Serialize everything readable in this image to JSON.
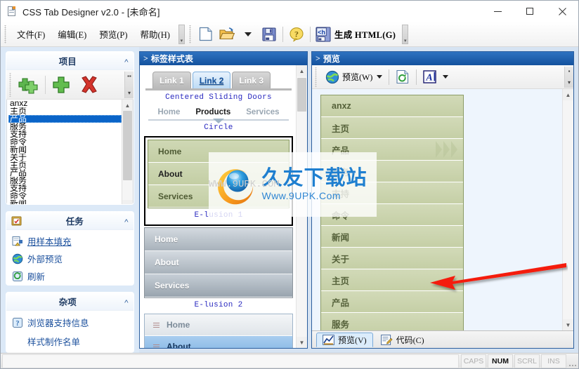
{
  "window": {
    "title": "CSS Tab Designer v2.0 - [未命名]",
    "icon": "document-icon",
    "minimize": "–",
    "maximize": "□",
    "close": "×"
  },
  "menu": {
    "items": [
      {
        "label": "文件(F)",
        "name": "menu-file"
      },
      {
        "label": "编辑(E)",
        "name": "menu-edit"
      },
      {
        "label": "预览(P)",
        "name": "menu-preview"
      },
      {
        "label": "帮助(H)",
        "name": "menu-help"
      }
    ]
  },
  "toolbar": {
    "buttons": [
      {
        "name": "new-file-button",
        "icon": "new-document-icon"
      },
      {
        "name": "open-file-button",
        "icon": "open-folder-icon"
      },
      {
        "name": "open-recent-dropdown",
        "icon": "chevron-down-icon"
      },
      {
        "name": "save-button",
        "icon": "floppy-disk-icon"
      },
      {
        "name": "help-button",
        "icon": "question-mark-icon"
      }
    ],
    "generate_html": {
      "label": "生成 HTML(G)",
      "icon": "generate-html-icon"
    }
  },
  "sidebar": {
    "items_panel": {
      "title": "项目",
      "collapse": "˄",
      "toolbar": [
        {
          "name": "add-multiple-items-button",
          "icon": "double-plus-icon"
        },
        {
          "name": "add-item-button",
          "icon": "plus-icon"
        },
        {
          "name": "delete-item-button",
          "icon": "red-x-icon"
        }
      ],
      "list": [
        {
          "label": "anxz",
          "selected": false
        },
        {
          "label": "主页",
          "selected": false
        },
        {
          "label": "产品",
          "selected": true
        },
        {
          "label": "服务",
          "selected": false
        },
        {
          "label": "支持",
          "selected": false
        },
        {
          "label": "命令",
          "selected": false
        },
        {
          "label": "新闻",
          "selected": false
        },
        {
          "label": "关于",
          "selected": false
        },
        {
          "label": "主页",
          "selected": false
        },
        {
          "label": "产品",
          "selected": false
        },
        {
          "label": "服务",
          "selected": false
        },
        {
          "label": "支持",
          "selected": false
        },
        {
          "label": "命令",
          "selected": false
        },
        {
          "label": "新闻",
          "selected": false
        }
      ]
    },
    "tasks_panel": {
      "title": "任务",
      "collapse": "˄",
      "icon": "clipboard-icon",
      "links": [
        {
          "label": "用样本填充",
          "icon": "fill-sample-icon",
          "underline": true
        },
        {
          "label": "外部预览",
          "icon": "globe-icon",
          "underline": false
        },
        {
          "label": "刷新",
          "icon": "refresh-icon",
          "underline": false
        }
      ]
    },
    "misc_panel": {
      "title": "杂项",
      "collapse": "˄",
      "links": [
        {
          "label": "浏览器支持信息",
          "icon": "browser-info-icon",
          "has_icon": true
        },
        {
          "label": "样式制作名单",
          "icon": "",
          "has_icon": false
        }
      ]
    }
  },
  "middle_panel": {
    "header": "标签样式表",
    "caret": ">",
    "sliding_doors": {
      "tabs": [
        {
          "label": "Link 1",
          "active": false
        },
        {
          "label": "Link 2",
          "active": true
        },
        {
          "label": "Link 3",
          "active": false
        }
      ],
      "caption": "Centered Sliding Doors"
    },
    "circle": {
      "items": [
        {
          "label": "Home",
          "active": false
        },
        {
          "label": "Products",
          "active": true
        },
        {
          "label": "Services",
          "active": false
        }
      ],
      "caption": "Circle"
    },
    "elusion1": {
      "items": [
        {
          "label": "Home",
          "dark": false
        },
        {
          "label": "About",
          "dark": true
        },
        {
          "label": "Services",
          "dark": false
        }
      ],
      "caption": "E-lusion 1"
    },
    "elusion2": {
      "items": [
        {
          "label": "Home",
          "on": false
        },
        {
          "label": "About",
          "on": false
        },
        {
          "label": "Services",
          "on": true
        }
      ],
      "caption": "E-lusion 2"
    },
    "bluelist": {
      "items": [
        {
          "label": "Home",
          "selected": false
        },
        {
          "label": "About",
          "selected": true
        }
      ]
    }
  },
  "preview_panel": {
    "header": "预览",
    "caret": ">",
    "toolbar": {
      "preview_button": {
        "label": "预览(W)",
        "icon": "globe-icon"
      },
      "refresh_button": {
        "name": "refresh-button",
        "icon": "refresh-page-icon"
      },
      "font_button": {
        "name": "font-button",
        "icon": "font-A-icon"
      }
    },
    "list": [
      {
        "label": "anxz",
        "chevrons": false
      },
      {
        "label": "主页",
        "chevrons": false
      },
      {
        "label": "产品",
        "chevrons": true
      },
      {
        "label": "服务",
        "chevrons": false
      },
      {
        "label": "支持",
        "chevrons": false
      },
      {
        "label": "命令",
        "chevrons": false
      },
      {
        "label": "新闻",
        "chevrons": false
      },
      {
        "label": "关于",
        "chevrons": false
      },
      {
        "label": "主页",
        "chevrons": false
      },
      {
        "label": "产品",
        "chevrons": false
      },
      {
        "label": "服务",
        "chevrons": false
      }
    ],
    "bottom_tabs": [
      {
        "label": "预览(V)",
        "icon": "preview-chart-icon",
        "active": true
      },
      {
        "label": "代码(C)",
        "icon": "code-edit-icon",
        "active": false
      }
    ]
  },
  "watermark": {
    "chinese": "久友下载站",
    "english": "Www.9UPK.Com",
    "ghost": "WWW.9UPK.COM"
  },
  "statusbar": {
    "cells": [
      {
        "label": "CAPS",
        "active": false
      },
      {
        "label": "NUM",
        "active": true
      },
      {
        "label": "SCRL",
        "active": false
      },
      {
        "label": "INS",
        "active": false
      }
    ]
  },
  "colors": {
    "accent": "#15529e",
    "dock_header": "#2e72c0",
    "selection": "#0a64c8",
    "green_menu": "#c5cfa6",
    "link": "#1a4f9c"
  }
}
